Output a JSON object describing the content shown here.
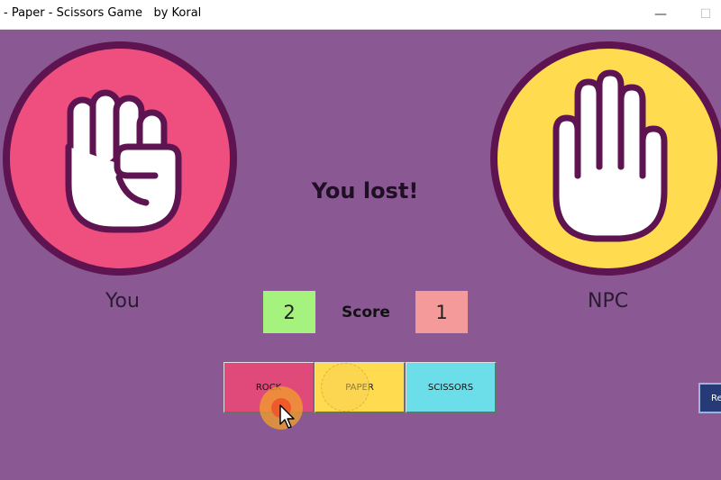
{
  "window": {
    "title": "- Paper - Scissors Game   by Koral",
    "minimize_glyph": "—",
    "maximize_glyph": "☐"
  },
  "player": {
    "label": "You",
    "choice_icon": "fist-rock-icon",
    "score": "2"
  },
  "npc": {
    "label": "NPC",
    "choice_icon": "open-hand-paper-icon",
    "score": "1"
  },
  "result_text": "You lost!",
  "score_label": "Score",
  "buttons": [
    {
      "label": "ROCK",
      "color": "#e04a7b"
    },
    {
      "label": "PAPER",
      "color": "#ffdb50"
    },
    {
      "label": "SCISSORS",
      "color": "#6bdeea"
    }
  ],
  "reset_label": "Re",
  "colors": {
    "background": "#8a5893",
    "player_circle": "#ef4f7e",
    "npc_circle": "#ffdb50",
    "circle_ring": "#5e1450",
    "player_score_bg": "#a6f27f",
    "npc_score_bg": "#f59a9a"
  }
}
